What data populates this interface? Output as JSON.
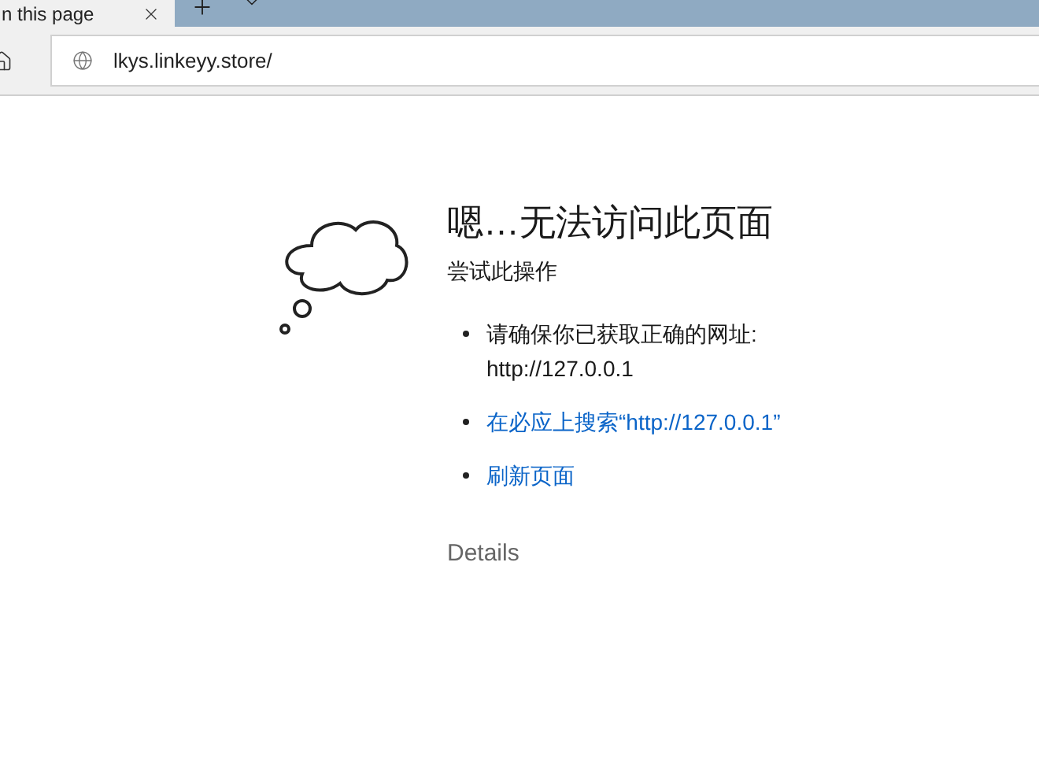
{
  "tab": {
    "title": "n this page",
    "selected": true
  },
  "address_bar": {
    "url": "lkys.linkeyy.store/"
  },
  "error": {
    "title": "嗯…无法访问此页面",
    "subtitle": "尝试此操作",
    "suggestions": [
      {
        "kind": "text",
        "lines": [
          "请确保你已获取正确的网址:",
          "http://127.0.0.1"
        ]
      },
      {
        "kind": "link",
        "lines": [
          "在必应上搜索“http://127.0.0.1”"
        ]
      },
      {
        "kind": "link",
        "lines": [
          "刷新页面"
        ]
      }
    ],
    "details": "Details"
  }
}
